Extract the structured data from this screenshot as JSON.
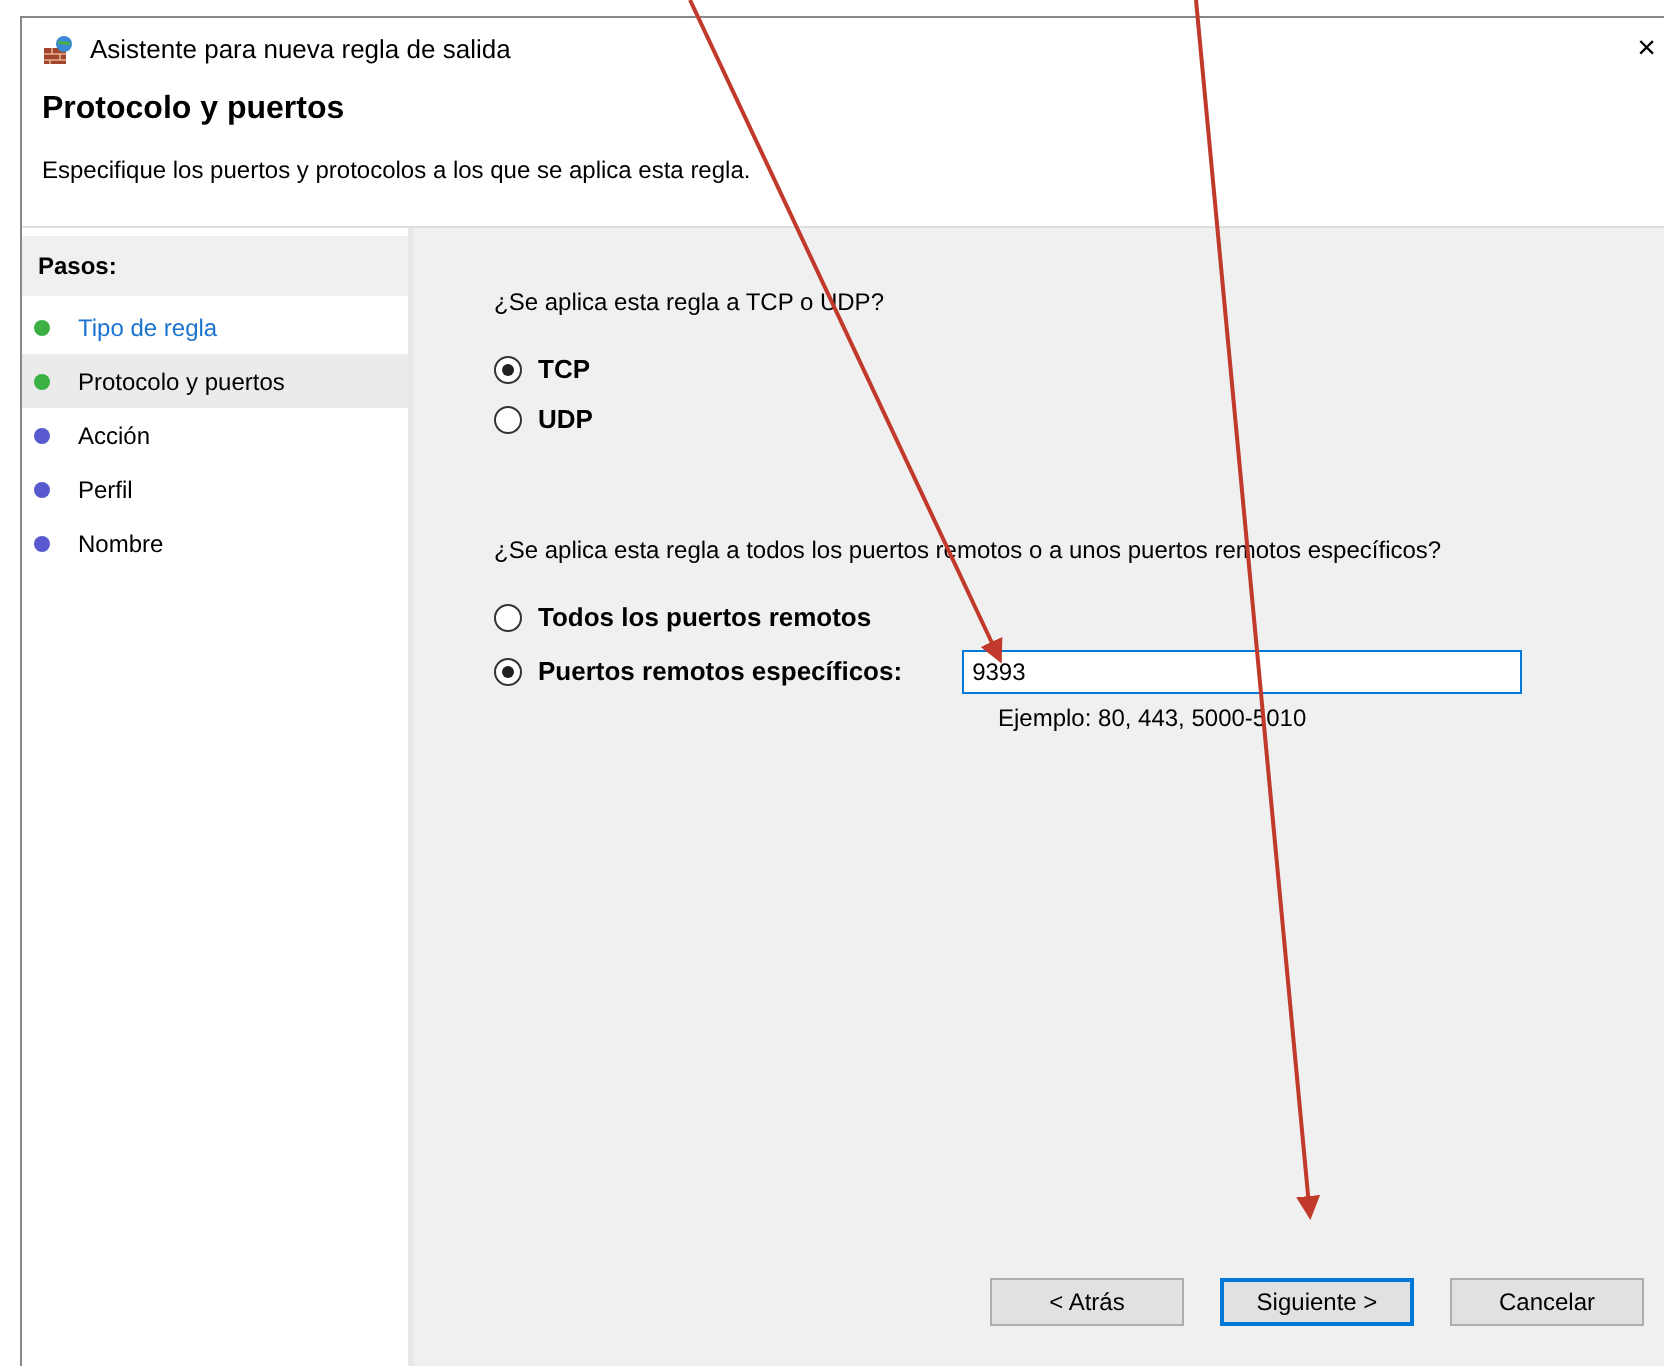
{
  "window": {
    "title": "Asistente para nueva regla de salida",
    "close": "×"
  },
  "header": {
    "title": "Protocolo y puertos",
    "description": "Especifique los puertos y protocolos a los que se aplica esta regla."
  },
  "steps": {
    "title": "Pasos:",
    "items": [
      {
        "label": "Tipo de regla",
        "color": "#3cb043",
        "selected": false,
        "link": true
      },
      {
        "label": "Protocolo y puertos",
        "color": "#3cb043",
        "selected": true,
        "link": false
      },
      {
        "label": "Acción",
        "color": "#5a5ad0",
        "selected": false,
        "link": false
      },
      {
        "label": "Perfil",
        "color": "#5a5ad0",
        "selected": false,
        "link": false
      },
      {
        "label": "Nombre",
        "color": "#5a5ad0",
        "selected": false,
        "link": false
      }
    ]
  },
  "protocol": {
    "question": "¿Se aplica esta regla a TCP o UDP?",
    "options": [
      {
        "label": "TCP",
        "selected": true
      },
      {
        "label": "UDP",
        "selected": false
      }
    ]
  },
  "ports": {
    "question": "¿Se aplica esta regla a todos los puertos remotos o a unos puertos remotos específicos?",
    "options": [
      {
        "label": "Todos los puertos remotos",
        "selected": false
      },
      {
        "label": "Puertos remotos específicos:",
        "selected": true
      }
    ],
    "value": "9393",
    "hint": "Ejemplo: 80, 443, 5000-5010"
  },
  "buttons": [
    {
      "label": "< Atrás",
      "default": false
    },
    {
      "label": "Siguiente >",
      "default": true
    },
    {
      "label": "Cancelar",
      "default": false
    }
  ],
  "annotations": [
    {
      "kind": "arrow"
    },
    {
      "kind": "arrow"
    }
  ]
}
